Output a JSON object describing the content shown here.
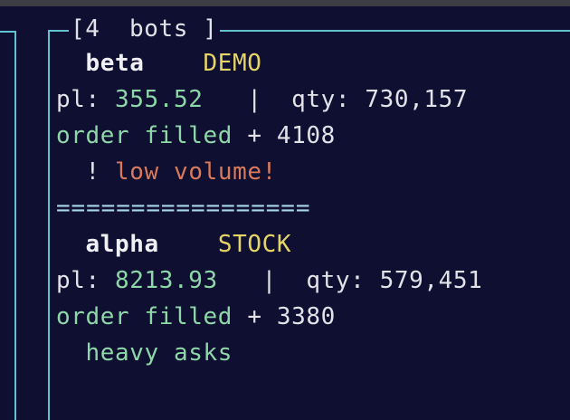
{
  "panel": {
    "title": "[4  bots ]"
  },
  "bots": [
    {
      "name": "beta",
      "tag": "DEMO",
      "pl_label": "pl:",
      "pl_value": "355.52",
      "divider": "|",
      "qty_label": "qty:",
      "qty_value": "730,157",
      "order_label": "order filled",
      "order_value": "+ 4108",
      "note_prefix": "!",
      "note": "low volume!"
    },
    {
      "name": "alpha",
      "tag": "STOCK",
      "pl_label": "pl:",
      "pl_value": "8213.93",
      "divider": "|",
      "qty_label": "qty:",
      "qty_value": "579,451",
      "order_label": "order filled",
      "order_value": "+ 3380",
      "note": "heavy asks"
    }
  ],
  "separator": "=================",
  "colors": {
    "background": "#0f0f32",
    "frame": "#62c3cf",
    "value_green": "#8ed7a9",
    "tag_yellow": "#e5d566",
    "warning": "#d97a5c"
  }
}
